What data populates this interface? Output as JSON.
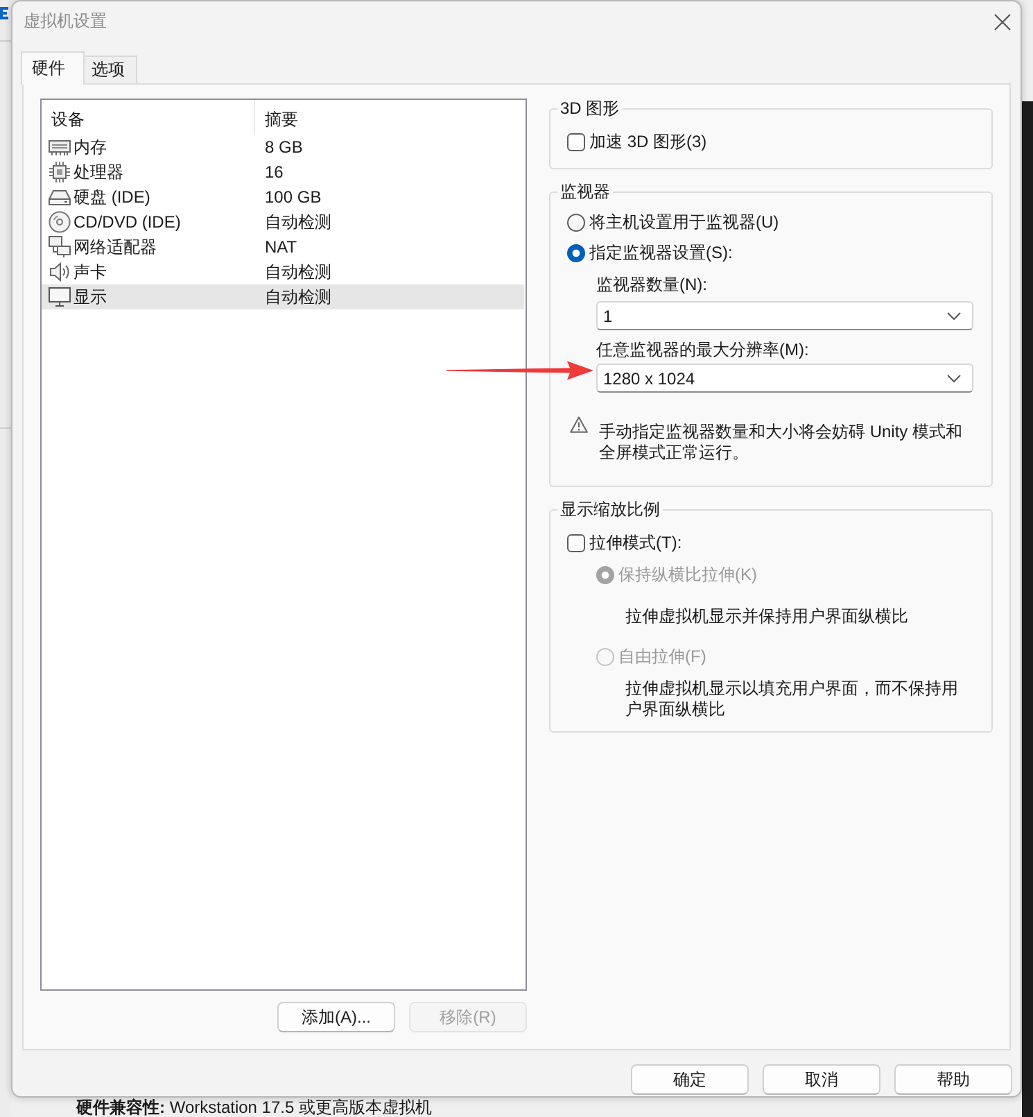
{
  "background": {
    "compatibility_text": "**硬件兼容性:** Workstation 17.5 或更高版本虚拟机"
  },
  "window": {
    "title": "虚拟机设置"
  },
  "tabs": [
    {
      "label": "硬件",
      "selected": true
    },
    {
      "label": "选项",
      "selected": false
    }
  ],
  "device_table": {
    "columns": [
      "设备",
      "摘要"
    ],
    "rows": [
      {
        "kind": "memory",
        "device": "内存",
        "summary": "8 GB",
        "selected": false
      },
      {
        "kind": "processor",
        "device": "处理器",
        "summary": "16",
        "selected": false
      },
      {
        "kind": "disk",
        "device": "硬盘 (IDE)",
        "summary": "100 GB",
        "selected": false
      },
      {
        "kind": "cdrom",
        "device": "CD/DVD (IDE)",
        "summary": "自动检测",
        "selected": false
      },
      {
        "kind": "network",
        "device": "网络适配器",
        "summary": "NAT",
        "selected": false
      },
      {
        "kind": "sound",
        "device": "声卡",
        "summary": "自动检测",
        "selected": false
      },
      {
        "kind": "display",
        "device": "显示",
        "summary": "自动检测",
        "selected": true
      }
    ]
  },
  "list_buttons": [
    {
      "label": "添加(A)...",
      "disabled": false
    },
    {
      "label": "移除(R)",
      "disabled": true
    }
  ],
  "graphics_3d": {
    "title": "3D 图形",
    "accelerate": {
      "label": "加速 3D 图形(3)",
      "checked": false
    }
  },
  "monitor": {
    "title": "监视器",
    "options": [
      {
        "label": "将主机设置用于监视器(U)",
        "selected": false
      },
      {
        "label": "指定监视器设置(S):",
        "selected": true
      }
    ],
    "count_label": "监视器数量(N):",
    "count_value": "1",
    "resolution_label": "任意监视器的最大分辨率(M):",
    "resolution_value": "1280 x 1024",
    "warning": "手动指定监视器数量和大小将会妨碍 Unity 模式和全屏模式正常运行。"
  },
  "display_scaling": {
    "title": "显示缩放比例",
    "stretch": {
      "label": "拉伸模式(T):",
      "checked": false
    },
    "options": [
      {
        "label": "保持纵横比拉伸(K)",
        "selected": true,
        "disabled": true,
        "description": "拉伸虚拟机显示并保持用户界面纵横比"
      },
      {
        "label": "自由拉伸(F)",
        "selected": false,
        "disabled": true,
        "description": "拉伸虚拟机显示以填充用户界面，而不保持用户界面纵横比"
      }
    ]
  },
  "dialog_buttons": [
    "确定",
    "取消",
    "帮助"
  ]
}
